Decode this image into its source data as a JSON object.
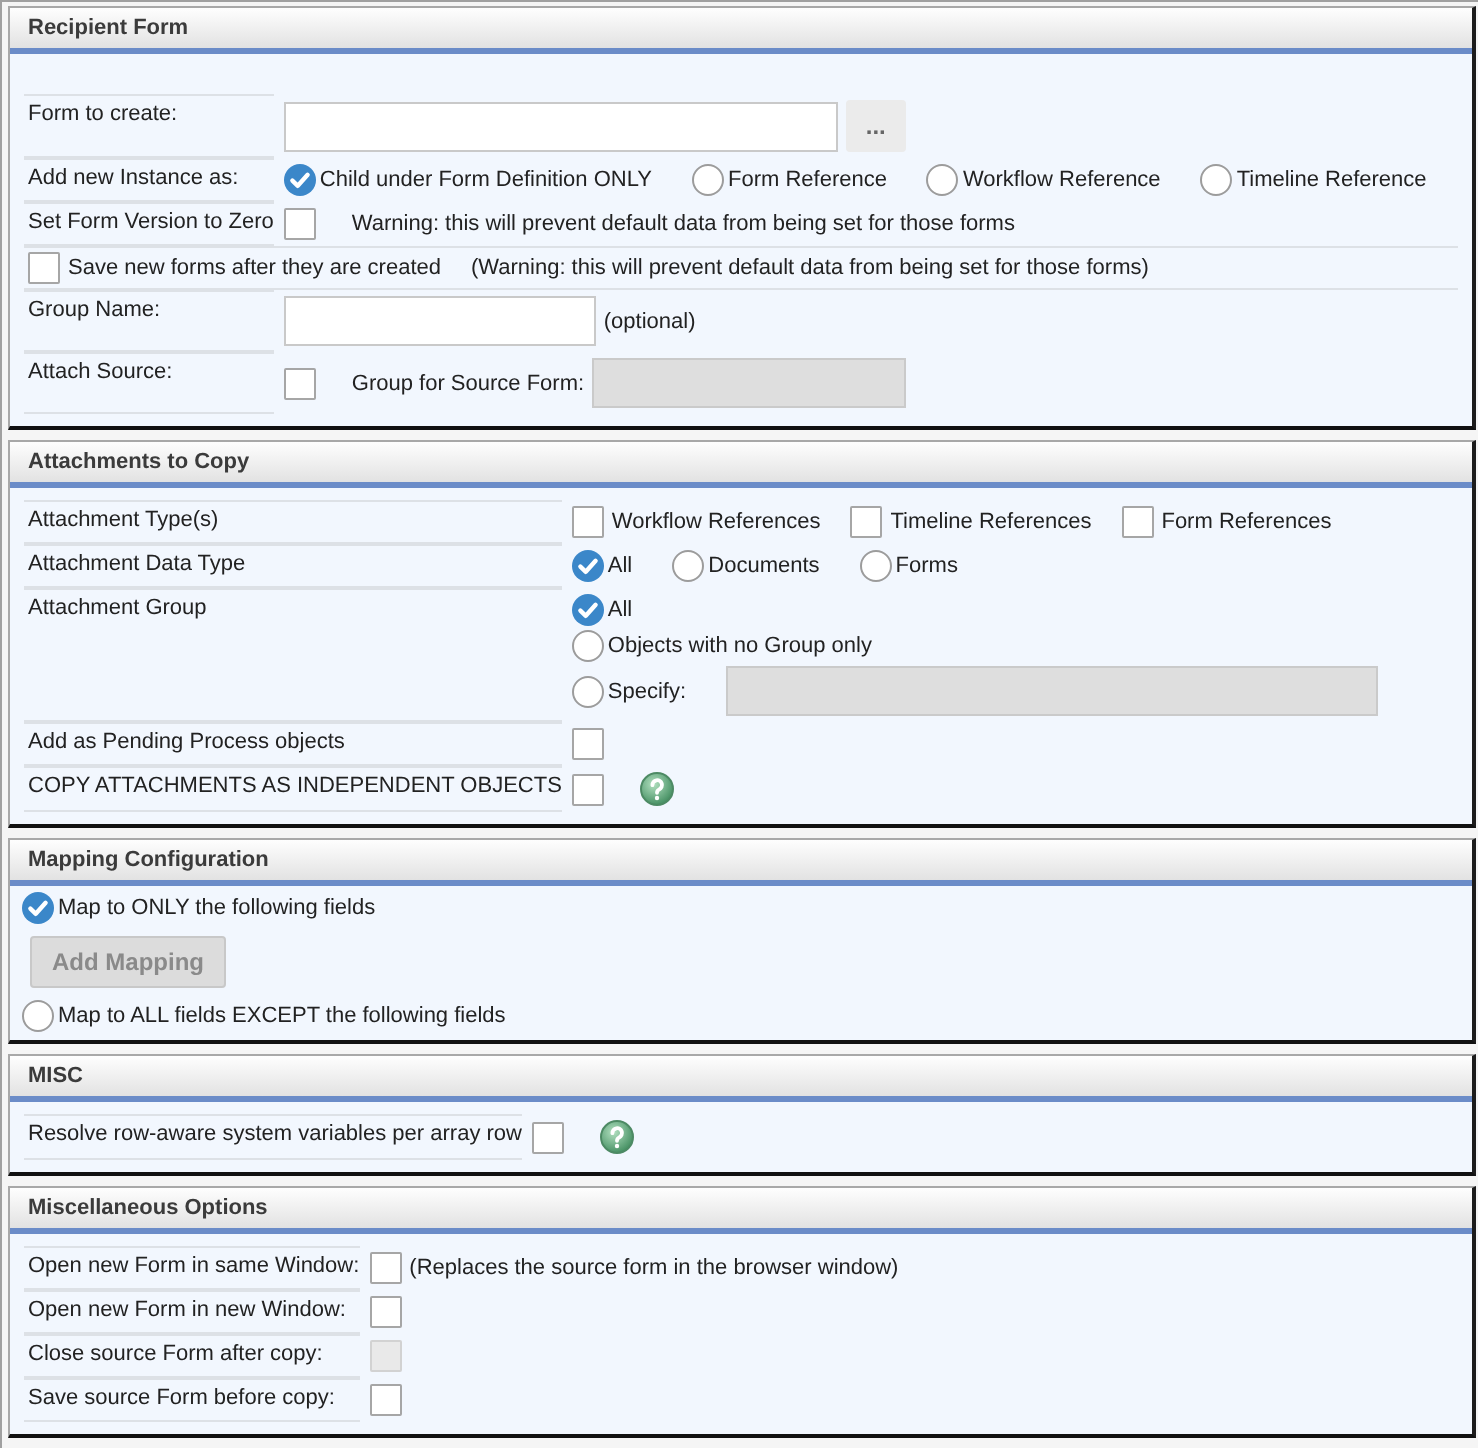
{
  "sections": [
    {
      "title": "Recipient Form",
      "kind": "grid",
      "rows": [
        {
          "label": "Form to create:",
          "controls": [
            {
              "kind": "field",
              "disabled": false
            },
            {
              "kind": "button",
              "text": "...",
              "disabled": false
            }
          ]
        },
        {
          "label": "Add new Instance as:",
          "controls": [
            {
              "kind": "radio",
              "text": "Child under Form Definition ONLY",
              "selected": true,
              "disabled": false
            },
            {
              "kind": "radio",
              "text": "Form Reference",
              "selected": false,
              "disabled": false
            },
            {
              "kind": "radio",
              "text": "Workflow Reference",
              "selected": false,
              "disabled": false
            },
            {
              "kind": "radio",
              "text": "Timeline Reference",
              "selected": false,
              "disabled": false
            }
          ]
        },
        {
          "label": "Set Form Version to Zero",
          "controls": [
            {
              "kind": "checkbox",
              "checked": false,
              "disabled": false
            },
            {
              "kind": "note",
              "text": "Warning: this will prevent default data from being set for those forms"
            }
          ]
        },
        {
          "controls": [
            {
              "kind": "checkbox",
              "text": "Save new forms after they are created",
              "checked": false,
              "disabled": false
            },
            {
              "kind": "note",
              "text": "(Warning: this will prevent default data from being set for those forms)"
            }
          ]
        },
        {
          "label": "Group Name:",
          "controls": [
            {
              "kind": "field",
              "disabled": false
            },
            {
              "kind": "note",
              "text": "(optional)"
            }
          ]
        },
        {
          "label": "Attach Source:",
          "controls": [
            {
              "kind": "checkbox",
              "checked": false,
              "disabled": false
            },
            {
              "kind": "note",
              "text": "Group for Source Form:"
            },
            {
              "kind": "field",
              "disabled": true
            }
          ]
        }
      ]
    },
    {
      "title": "Attachments to Copy",
      "kind": "grid",
      "rows": [
        {
          "label": "Attachment Type(s)",
          "controls": [
            {
              "kind": "checkbox",
              "text": "Workflow References",
              "checked": false,
              "disabled": false
            },
            {
              "kind": "checkbox",
              "text": "Timeline References",
              "checked": false,
              "disabled": false
            },
            {
              "kind": "checkbox",
              "text": "Form References",
              "checked": false,
              "disabled": false
            }
          ]
        },
        {
          "label": "Attachment Data Type",
          "controls": [
            {
              "kind": "radio",
              "text": "All",
              "selected": true,
              "disabled": false
            },
            {
              "kind": "radio",
              "text": "Documents",
              "selected": false,
              "disabled": false
            },
            {
              "kind": "radio",
              "text": "Forms",
              "selected": false,
              "disabled": false
            }
          ]
        },
        {
          "label": "Attachment Group",
          "lines": [
            [
              {
                "kind": "radio",
                "text": "All",
                "selected": true,
                "disabled": false
              }
            ],
            [
              {
                "kind": "radio",
                "text": "Objects with no Group only",
                "selected": false,
                "disabled": false
              }
            ],
            [
              {
                "kind": "radio",
                "text": "Specify:",
                "selected": false,
                "disabled": false
              },
              {
                "kind": "field",
                "disabled": true
              }
            ]
          ]
        },
        {
          "label": "Add as Pending Process objects",
          "controls": [
            {
              "kind": "checkbox",
              "checked": false,
              "disabled": false
            }
          ]
        },
        {
          "label": "COPY ATTACHMENTS AS INDEPENDENT OBJECTS",
          "controls": [
            {
              "kind": "checkbox",
              "checked": false,
              "disabled": false
            },
            {
              "kind": "help"
            }
          ]
        }
      ]
    },
    {
      "title": "Mapping Configuration",
      "kind": "list",
      "rows": [
        {
          "controls": [
            {
              "kind": "radio",
              "text": "Map to ONLY the following fields",
              "selected": true,
              "disabled": false
            }
          ]
        },
        {
          "controls": [
            {
              "kind": "button",
              "text": "Add Mapping",
              "disabled": true
            }
          ]
        },
        {
          "controls": [
            {
              "kind": "radio",
              "text": "Map to ALL fields EXCEPT the following fields",
              "selected": false,
              "disabled": false
            }
          ]
        }
      ]
    },
    {
      "title": "MISC",
      "kind": "grid",
      "rows": [
        {
          "label": "Resolve row-aware system variables per array row",
          "controls": [
            {
              "kind": "checkbox",
              "checked": false,
              "disabled": false
            },
            {
              "kind": "help"
            }
          ]
        }
      ]
    },
    {
      "title": "Miscellaneous Options",
      "kind": "grid",
      "rows": [
        {
          "label": "Open new Form in same Window:",
          "controls": [
            {
              "kind": "checkbox",
              "checked": false,
              "disabled": false
            },
            {
              "kind": "note",
              "text": "(Replaces the source form in the browser window)"
            }
          ]
        },
        {
          "label": "Open new Form in new Window:",
          "controls": [
            {
              "kind": "checkbox",
              "checked": false,
              "disabled": false
            }
          ]
        },
        {
          "label": "Close source Form after copy:",
          "controls": [
            {
              "kind": "checkbox",
              "checked": false,
              "disabled": true
            }
          ]
        },
        {
          "label": "Save source Form before copy:",
          "controls": [
            {
              "kind": "checkbox",
              "checked": false,
              "disabled": false
            }
          ]
        }
      ]
    }
  ]
}
